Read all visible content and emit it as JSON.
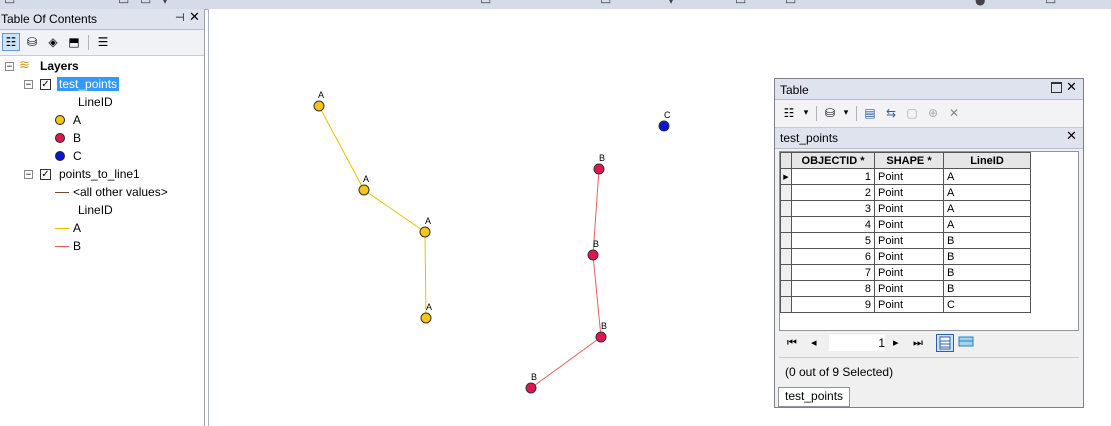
{
  "toc": {
    "title": "Table Of Contents",
    "root_label": "Layers",
    "layers": [
      {
        "name": "test_points",
        "checked": true,
        "selected": true,
        "field": "LineID",
        "classes": [
          {
            "label": "A",
            "color": "#f5c518",
            "symbol": "circle"
          },
          {
            "label": "B",
            "color": "#e0174f",
            "symbol": "circle"
          },
          {
            "label": "C",
            "color": "#0a16d6",
            "symbol": "circle"
          }
        ]
      },
      {
        "name": "points_to_line1",
        "checked": true,
        "other_label": "<all other values>",
        "field": "LineID",
        "classes": [
          {
            "label": "A",
            "color": "#e8c000",
            "symbol": "line"
          },
          {
            "label": "B",
            "color": "#e86060",
            "symbol": "line"
          }
        ]
      }
    ]
  },
  "map": {
    "point_labels": [
      "A",
      "A",
      "A",
      "A",
      "B",
      "B",
      "B",
      "B",
      "C"
    ]
  },
  "table_window": {
    "title": "Table",
    "tab_header": "test_points",
    "columns": [
      "OBJECTID *",
      "SHAPE *",
      "LineID"
    ],
    "rows": [
      [
        "1",
        "Point",
        "A"
      ],
      [
        "2",
        "Point",
        "A"
      ],
      [
        "3",
        "Point",
        "A"
      ],
      [
        "4",
        "Point",
        "A"
      ],
      [
        "5",
        "Point",
        "B"
      ],
      [
        "6",
        "Point",
        "B"
      ],
      [
        "7",
        "Point",
        "B"
      ],
      [
        "8",
        "Point",
        "B"
      ],
      [
        "9",
        "Point",
        "C"
      ]
    ],
    "current_record": "1",
    "status": "(0 out of 9 Selected)",
    "bottom_tab": "test_points"
  },
  "colors": {
    "selection": "#3399ff",
    "panel_title": "#dfe3ee",
    "line_a": "#e8c000",
    "line_b": "#e86060"
  }
}
